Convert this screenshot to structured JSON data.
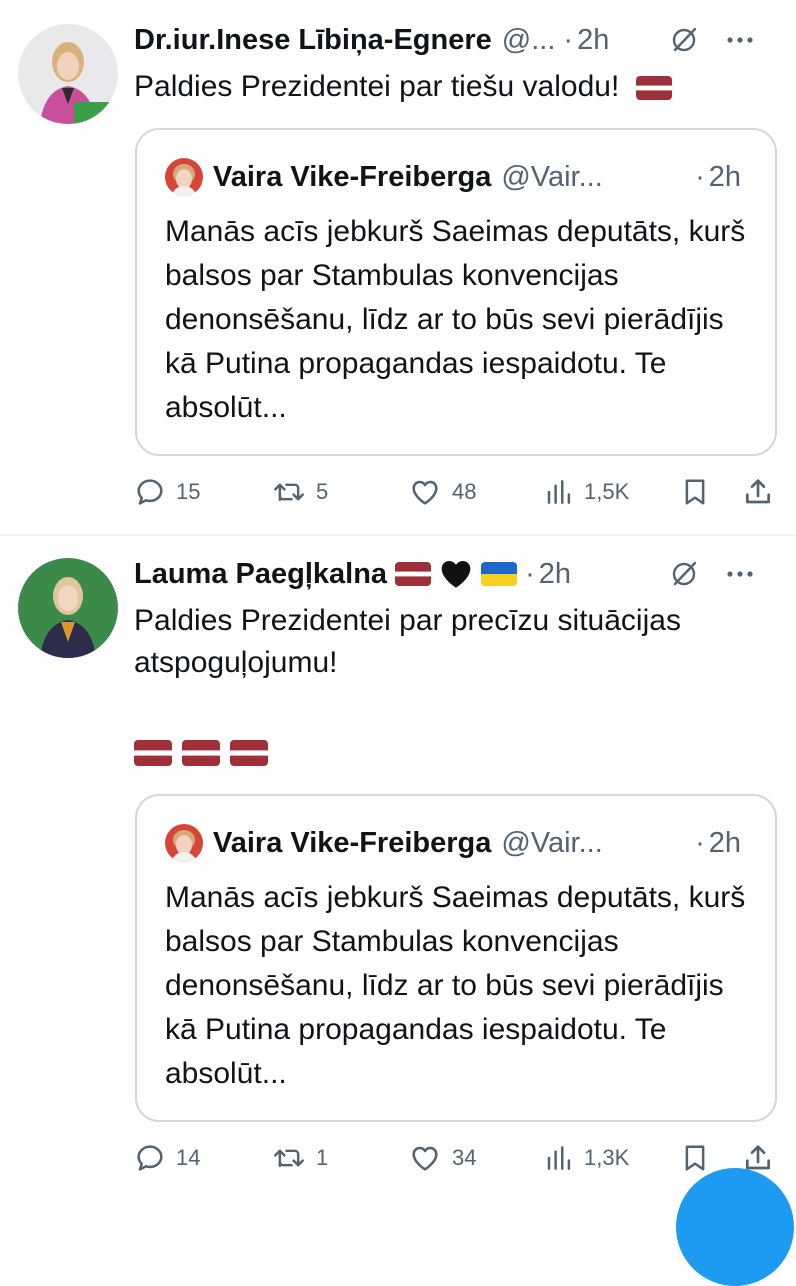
{
  "colors": {
    "text_primary": "#0f1419",
    "text_secondary": "#536471",
    "border": "#cfd9de",
    "accent": "#1d9bf0",
    "latvia_red": "#9e3039"
  },
  "tweets": [
    {
      "author_name": "Dr.iur.Inese Lībiņa-Egnere",
      "handle": "@...",
      "separator": "·",
      "time": "2h",
      "text": "Paldies Prezidentei par tiešu valodu!",
      "avatar_icon": "user-avatar",
      "quote": {
        "author_name": "Vaira Vike-Freiberga",
        "handle": "@Vair...",
        "separator": "·",
        "time": "2h",
        "text": "Manās acīs jebkurš Saeimas deputāts, kurš balsos par Stambulas konvencijas denonsēšanu, līdz ar to būs sevi pierādījis kā Putina propagandas iespaidotu. Te absolūt..."
      },
      "stats": {
        "replies": "15",
        "reposts": "5",
        "likes": "48",
        "views": "1,5K"
      }
    },
    {
      "author_name": "Lauma Paegļkalna",
      "separator": "·",
      "time": "2h",
      "text_line1": "Paldies Prezidentei par precīzu situācijas",
      "text_line2": "atspoguļojumu!",
      "avatar_icon": "user-avatar",
      "quote": {
        "author_name": "Vaira Vike-Freiberga",
        "handle": "@Vair...",
        "separator": "·",
        "time": "2h",
        "text": "Manās acīs jebkurš Saeimas deputāts, kurš balsos par Stambulas konvencijas denonsēšanu, līdz ar to būs sevi pierādījis kā Putina propagandas iespaidotu. Te absolūt..."
      },
      "stats": {
        "replies": "14",
        "reposts": "1",
        "likes": "34",
        "views": "1,3K"
      }
    }
  ]
}
